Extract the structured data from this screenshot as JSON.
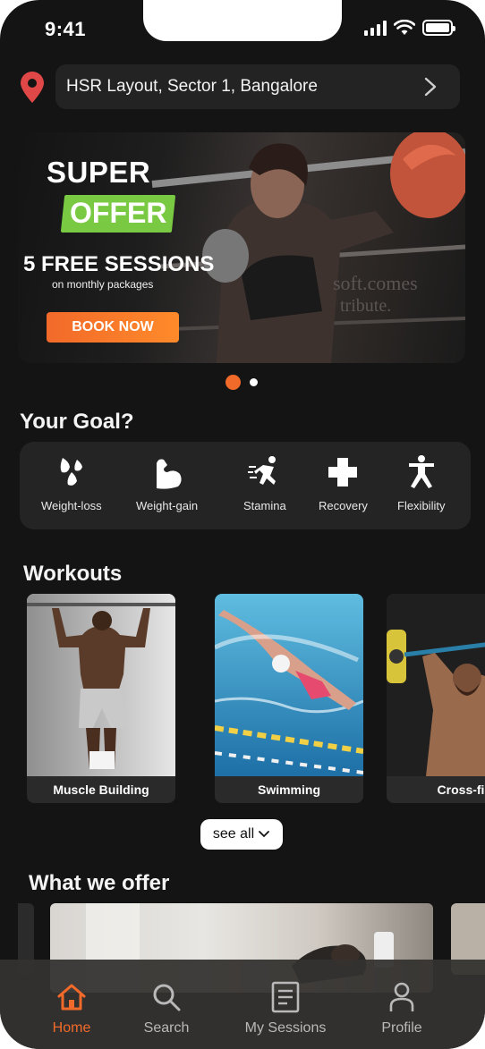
{
  "status_bar": {
    "time": "9:41"
  },
  "location": {
    "text": "HSR Layout, Sector 1, Bangalore"
  },
  "banner": {
    "super": "SUPER",
    "offer": "OFFER",
    "headline": "5 FREE SESSIONS",
    "subline": "on monthly packages",
    "cta": "BOOK NOW",
    "slides_count": 2,
    "active_slide": 1
  },
  "goals": {
    "title": "Your Goal?",
    "items": [
      {
        "label": "Weight-loss",
        "icon": "droplets-icon"
      },
      {
        "label": "Weight-gain",
        "icon": "bicep-icon"
      },
      {
        "label": "Stamina",
        "icon": "runner-icon"
      },
      {
        "label": "Recovery",
        "icon": "plus-cross-icon"
      },
      {
        "label": "Flexibility",
        "icon": "stretch-figure-icon"
      }
    ]
  },
  "workouts": {
    "title": "Workouts",
    "items": [
      {
        "label": "Muscle Building"
      },
      {
        "label": "Swimming"
      },
      {
        "label": "Cross-fi"
      }
    ],
    "see_all": "see all"
  },
  "offers": {
    "title": "What we offer"
  },
  "nav": {
    "items": [
      {
        "label": "Home",
        "icon": "home-icon",
        "active": true
      },
      {
        "label": "Search",
        "icon": "search-icon",
        "active": false
      },
      {
        "label": "My Sessions",
        "icon": "sessions-list-icon",
        "active": false
      },
      {
        "label": "Profile",
        "icon": "profile-icon",
        "active": false
      }
    ]
  },
  "colors": {
    "accent": "#f26a2a",
    "offer_green": "#7ac943",
    "background": "#141414",
    "pin_red": "#e04848"
  }
}
